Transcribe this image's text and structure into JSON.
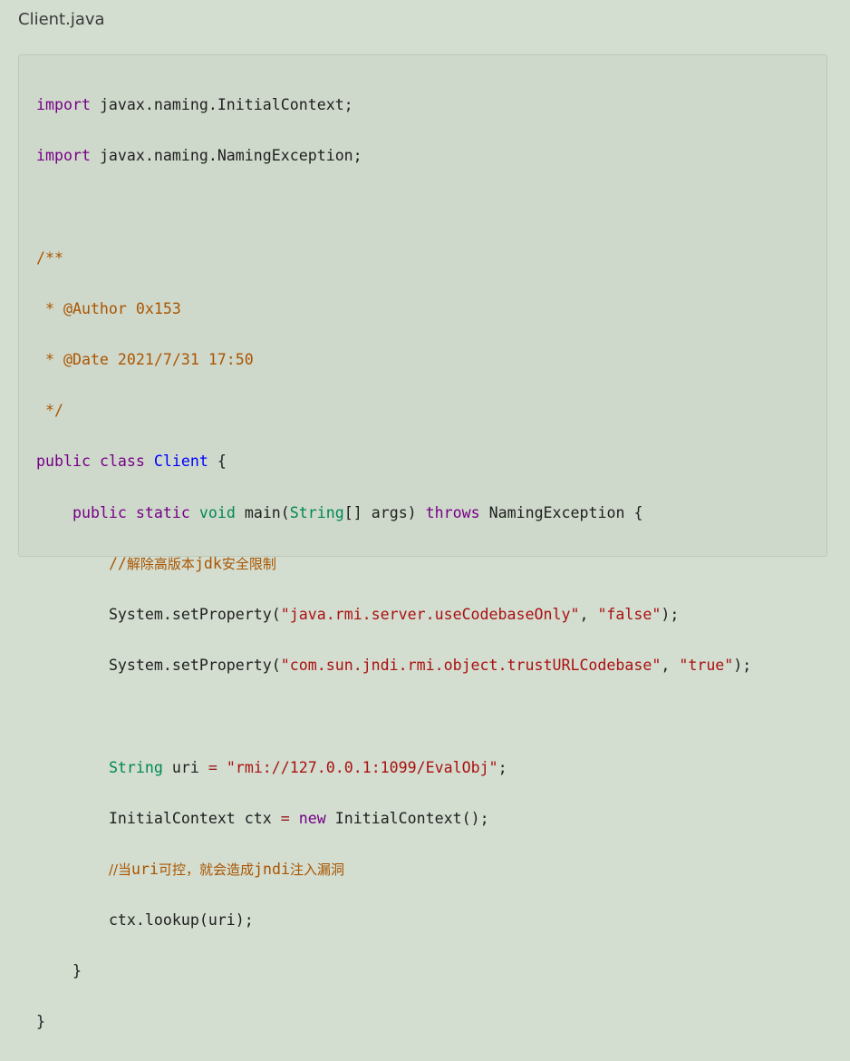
{
  "file": {
    "name": "Client.java"
  },
  "code": {
    "l1": {
      "kw": "import",
      "rest": " javax.naming.InitialContext;"
    },
    "l2": {
      "kw": "import",
      "rest": " javax.naming.NamingException;"
    },
    "l4": "/**",
    "l5": " * @Author 0x153",
    "l6": " * @Date 2021/7/31 17:50",
    "l7": " */",
    "l8": {
      "kw1": "public",
      "kw2": "class",
      "cls": "Client",
      "brace": " {"
    },
    "l9": {
      "indent": "    ",
      "kw1": "public",
      "kw2": "static",
      "kw3": "void",
      "name": " main(",
      "type": "String",
      "args": "[] args) ",
      "kw4": "throws",
      "rest": " NamingException {"
    },
    "l10": {
      "indent": "        ",
      "prefix": "//",
      "text": "解除高版本",
      "mid": "jdk",
      "text2": "安全限制"
    },
    "l11": {
      "indent": "        ",
      "call": "System.setProperty(",
      "s1": "\"java.rmi.server.useCodebaseOnly\"",
      "sep": ", ",
      "s2": "\"false\"",
      "end": ");"
    },
    "l12": {
      "indent": "        ",
      "call": "System.setProperty(",
      "s1": "\"com.sun.jndi.rmi.object.trustURLCodebase\"",
      "sep": ", ",
      "s2": "\"true\"",
      "end": ");"
    },
    "l14": {
      "indent": "        ",
      "type": "String",
      "var": " uri ",
      "op": "=",
      "sp": " ",
      "str": "\"rmi://127.0.0.1:1099/EvalObj\"",
      "end": ";"
    },
    "l15": {
      "indent": "        ",
      "cls": "InitialContext ctx ",
      "op": "=",
      "sp": " ",
      "kw": "new",
      "rest": " InitialContext();"
    },
    "l16": {
      "indent": "        ",
      "prefix": "//当",
      "mid": "uri",
      "text": "可控，就会造成",
      "mid2": "jndi",
      "text2": "注入漏洞"
    },
    "l17": {
      "indent": "        ",
      "text": "ctx.lookup(uri);"
    },
    "l18": {
      "indent": "    ",
      "text": "}"
    },
    "l19": {
      "text": "}"
    }
  }
}
